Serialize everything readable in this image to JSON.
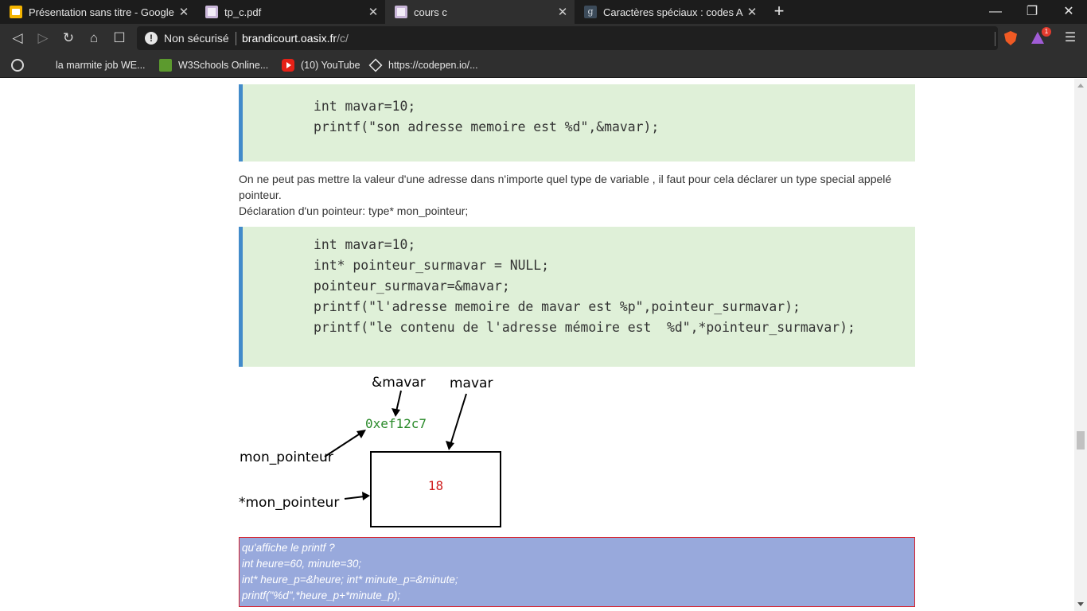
{
  "browser": {
    "tabs": [
      {
        "title": "Présentation sans titre - Google Slides",
        "favicon": "google-slides-icon",
        "active": false
      },
      {
        "title": "tp_c.pdf",
        "favicon": "document-icon",
        "active": false
      },
      {
        "title": "cours c",
        "favicon": "document-icon",
        "active": true
      },
      {
        "title": "Caractères spéciaux : codes ASCII et HTML",
        "favicon": "g-site-icon",
        "active": false
      }
    ],
    "new_tab_glyph": "+",
    "security_label": "Non sécurisé",
    "url_host": "brandicourt.oasix.fr",
    "url_path": "/c/",
    "rewards_badge": "1",
    "bookmarks": [
      {
        "label": "",
        "icon": "globe-icon"
      },
      {
        "label": "la marmite job WE...",
        "icon": ""
      },
      {
        "label": "W3Schools Online...",
        "icon": "w3schools-icon"
      },
      {
        "label": "(10) YouTube",
        "icon": "youtube-icon"
      },
      {
        "label": "https://codepen.io/...",
        "icon": "codepen-icon"
      }
    ]
  },
  "page": {
    "code_block_1": "int mavar=10;\nprintf(\"son adresse memoire est %d\",&mavar);",
    "paragraph_lines": [
      "On ne peut pas mettre la valeur d'une adresse dans n'importe quel type de variable , il faut pour cela déclarer un type special appelé pointeur.",
      "Déclaration d'un pointeur: type* mon_pointeur;"
    ],
    "code_block_2": "int mavar=10;\nint* pointeur_surmavar = NULL;\npointeur_surmavar=&mavar;\nprintf(\"l'adresse memoire de mavar est %p\",pointeur_surmavar);\nprintf(\"le contenu de l'adresse mémoire est  %d\",*pointeur_surmavar);",
    "diagram": {
      "label_address_of": "&mavar",
      "label_variable": "mavar",
      "address_value": "0xef12c7",
      "label_pointer": "mon_pointeur",
      "label_dereference": "*mon_pointeur",
      "stored_value": "18"
    },
    "exercise_lines": [
      "qu'affiche le printf ?",
      "int heure=60, minute=30;",
      "int* heure_p=&heure; int* minute_p=&minute;",
      "printf(\"%d\",*heure_p+*minute_p);"
    ]
  },
  "colors": {
    "code_background": "#dff0d8",
    "code_border": "#428bca",
    "address_text": "#2a8a2a",
    "value_text": "#d02020",
    "exercise_background": "#98a9dc",
    "exercise_border": "#d9202a"
  }
}
